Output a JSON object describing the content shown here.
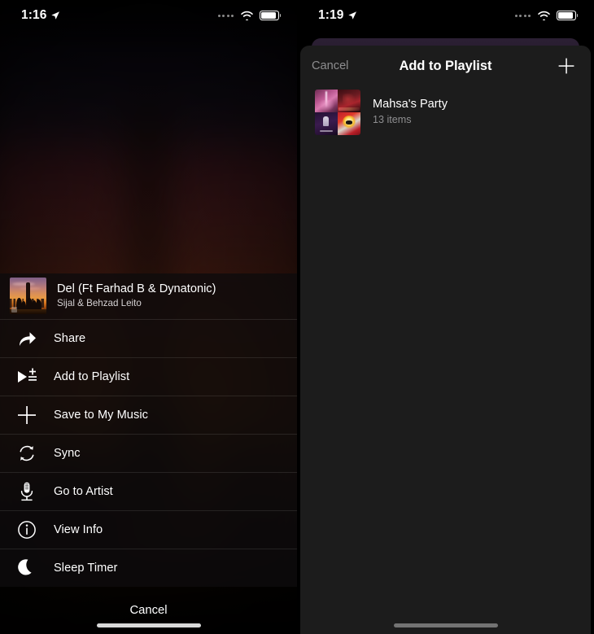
{
  "left": {
    "status_bar": {
      "time": "1:16",
      "location_icon": "location-arrow-icon",
      "cellular_icon": "cellular-dots-icon",
      "wifi_icon": "wifi-icon",
      "battery_icon": "battery-icon"
    },
    "now_playing": {
      "artwork": "album-artwork",
      "title": "Del (Ft Farhad B & Dynatonic)",
      "artist": "Sijal & Behzad Leito"
    },
    "actions": [
      {
        "label": "Share",
        "icon": "share-icon"
      },
      {
        "label": "Add to Playlist",
        "icon": "add-to-playlist-icon"
      },
      {
        "label": "Save to My Music",
        "icon": "plus-icon"
      },
      {
        "label": "Sync",
        "icon": "sync-icon"
      },
      {
        "label": "Go to Artist",
        "icon": "microphone-icon"
      },
      {
        "label": "View Info",
        "icon": "info-circle-icon"
      },
      {
        "label": "Sleep Timer",
        "icon": "moon-icon"
      }
    ],
    "cancel_label": "Cancel"
  },
  "right": {
    "status_bar": {
      "time": "1:19",
      "location_icon": "location-arrow-icon",
      "cellular_icon": "cellular-dots-icon",
      "wifi_icon": "wifi-icon",
      "battery_icon": "battery-icon"
    },
    "navbar": {
      "cancel_label": "Cancel",
      "title": "Add to Playlist",
      "add_icon": "plus-icon"
    },
    "playlists": [
      {
        "name": "Mahsa's Party",
        "count": "13 items",
        "artwork": "playlist-artwork-mosaic"
      }
    ]
  },
  "colors": {
    "background": "#000000",
    "sheet": "#1c1c1c",
    "text_primary": "#ffffff",
    "text_secondary": "#8e8e90",
    "separator": "rgba(255,255,255,0.10)",
    "card_behind": "#2b1f33"
  }
}
